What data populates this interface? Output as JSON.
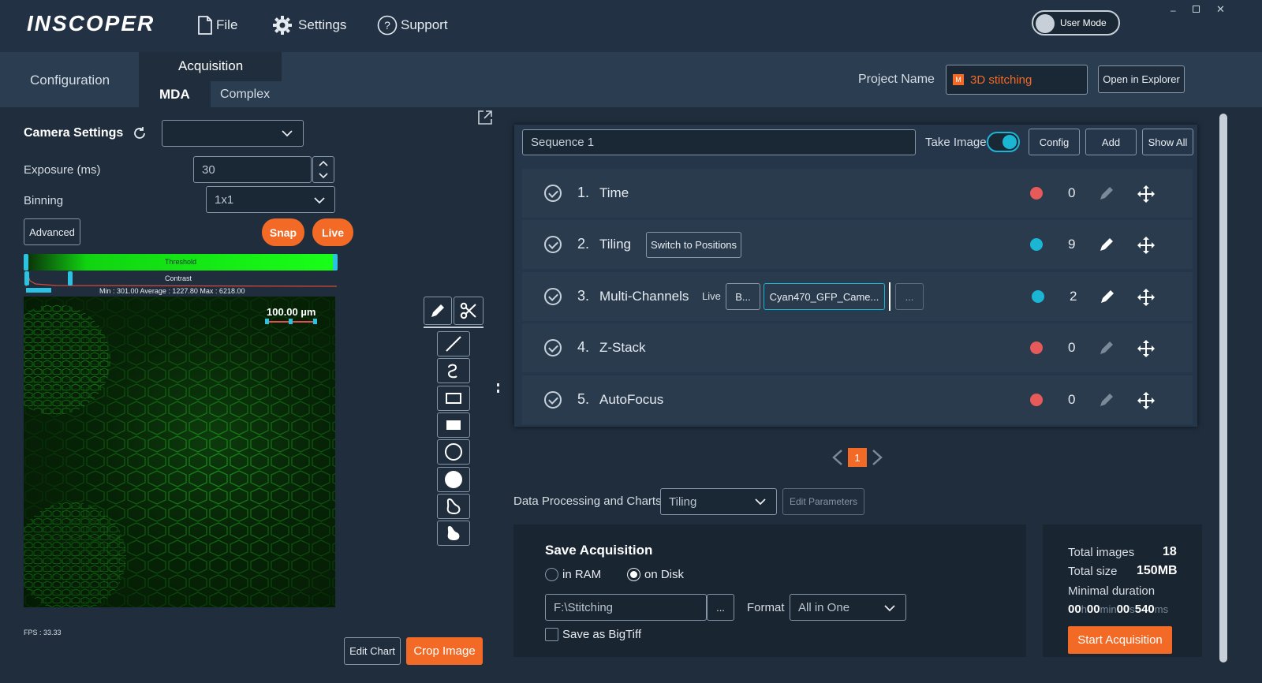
{
  "app": {
    "brand": "INSCOPER",
    "accent": "#f26a25",
    "teal": "#1ab6d4"
  },
  "menu": {
    "file": "File",
    "settings": "Settings",
    "support": "Support",
    "user_mode": "User Mode"
  },
  "tabs": {
    "configuration": "Configuration",
    "acquisition": "Acquisition",
    "mda": "MDA",
    "complex": "Complex"
  },
  "project": {
    "label": "Project Name",
    "value": "3D stitching",
    "open_explorer": "Open in Explorer"
  },
  "camera": {
    "title": "Camera Settings",
    "exposure_label": "Exposure (ms)",
    "exposure_value": "30",
    "binning_label": "Binning",
    "binning_value": "1x1",
    "advanced": "Advanced",
    "snap": "Snap",
    "live": "Live",
    "threshold": "Threshold",
    "contrast": "Contrast",
    "stats": "Min : 301.00 Average : 1227.80 Max : 6218.00",
    "scale": "100.00 µm",
    "fps": "FPS : 33.33",
    "edit_chart": "Edit Chart",
    "crop_image": "Crop Image"
  },
  "sequence": {
    "name": "Sequence 1",
    "take_image": "Take Image",
    "take_image_on": true,
    "config": "Config",
    "add": "Add",
    "show_all": "Show All",
    "rows": [
      {
        "num": "1.",
        "title": "Time",
        "count": "0",
        "status": "red"
      },
      {
        "num": "2.",
        "title": "Tiling",
        "count": "9",
        "status": "teal",
        "extra": "Switch to Positions"
      },
      {
        "num": "3.",
        "title": "Multi-Channels",
        "count": "2",
        "status": "teal",
        "live": "Live",
        "b": "B...",
        "channel": "Cyan470_GFP_Came...",
        "more": "..."
      },
      {
        "num": "4.",
        "title": "Z-Stack",
        "count": "0",
        "status": "red"
      },
      {
        "num": "5.",
        "title": "AutoFocus",
        "count": "0",
        "status": "red"
      }
    ],
    "page": "1"
  },
  "processing": {
    "label": "Data Processing and Charts",
    "value": "Tiling",
    "edit_params": "Edit Parameters"
  },
  "save": {
    "title": "Save Acquisition",
    "in_ram": "in RAM",
    "on_disk": "on Disk",
    "path": "F:\\Stitching",
    "browse": "...",
    "format_label": "Format",
    "format_value": "All in One",
    "bigtiff": "Save as BigTiff"
  },
  "summary": {
    "total_images_label": "Total images",
    "total_images": "18",
    "total_size_label": "Total size",
    "total_size": "150MB",
    "duration_label": "Minimal duration",
    "h": "00",
    "h_unit": "h",
    "min": "00",
    "min_unit": "min",
    "s": "00",
    "s_unit": "s",
    "ms": "540",
    "ms_unit": "ms",
    "start": "Start Acquisition"
  }
}
